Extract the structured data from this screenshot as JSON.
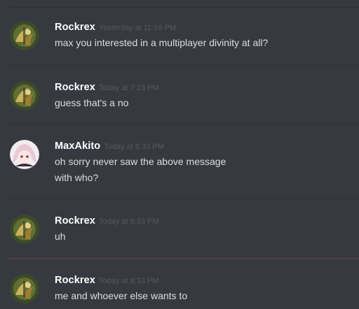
{
  "messages": [
    {
      "author": "Rockrex",
      "timestamp": "Yesterday at 11:16 PM",
      "avatar": "rockrex-avatar",
      "lines": [
        "max you interested in a multiplayer divinity at all?"
      ]
    },
    {
      "author": "Rockrex",
      "timestamp": "Today at 7:23 PM",
      "avatar": "rockrex-avatar",
      "lines": [
        "guess that's a no"
      ]
    },
    {
      "author": "MaxAkito",
      "timestamp": "Today at 8:33 PM",
      "avatar": "maxakito-avatar",
      "lines": [
        "oh sorry never saw the above message",
        "with who?"
      ]
    },
    {
      "author": "Rockrex",
      "timestamp": "Today at 8:33 PM",
      "avatar": "rockrex-avatar",
      "lines": [
        "uh"
      ]
    },
    {
      "author": "Rockrex",
      "timestamp": "Today at 8:33 PM",
      "avatar": "rockrex-avatar",
      "lines": [
        "me and whoever else wants to"
      ]
    }
  ],
  "colors": {
    "background": "#36393f",
    "username": "#ffffff",
    "timestamp": "#57595e",
    "message_text": "#dcddde",
    "divider": "#2f3136",
    "new_messages_divider": "#6e4247"
  }
}
